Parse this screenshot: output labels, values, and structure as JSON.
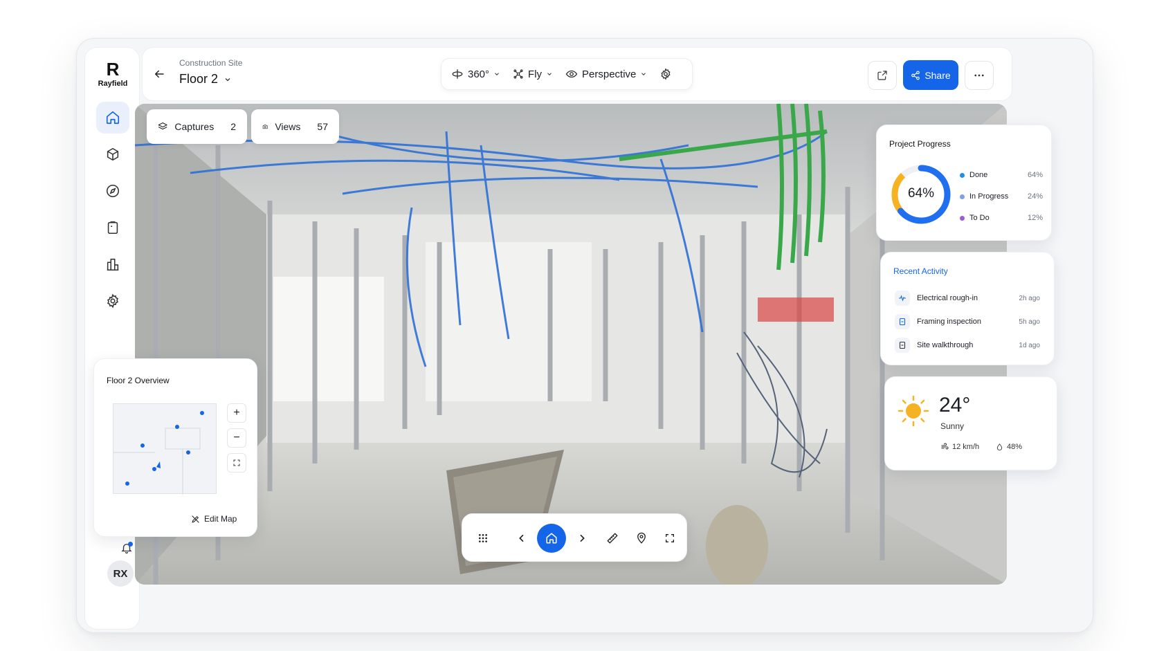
{
  "app": {
    "logo_text": "Rayfield",
    "logo_mark": "R"
  },
  "header": {
    "breadcrumb": "Construction Site",
    "title": "Floor 2",
    "toolbar": {
      "view_mode": "360°",
      "navigation": "Fly",
      "camera": "Perspective"
    },
    "share_label": "Share"
  },
  "sidebar": {
    "items": [
      {
        "icon": "home-icon",
        "active": true
      },
      {
        "icon": "cube-icon"
      },
      {
        "icon": "compass-icon"
      },
      {
        "icon": "clipboard-icon"
      },
      {
        "icon": "bar-chart-icon"
      },
      {
        "icon": "gear-icon"
      }
    ],
    "user_initials": "RX"
  },
  "chips": {
    "captures": {
      "label": "Captures",
      "count": "2"
    },
    "views": {
      "label": "Views",
      "count": "57"
    }
  },
  "progress": {
    "title": "Project Progress",
    "center_label": "64%",
    "items": [
      {
        "label": "Done",
        "value": "64%",
        "color": "#1565e8"
      },
      {
        "label": "In Progress",
        "value": "24%",
        "color": "#6d8fe0"
      },
      {
        "label": "To Do",
        "value": "12%",
        "color": "#9b5cd6"
      }
    ],
    "ring_colors": {
      "done": "#1f6ff0",
      "in_progress": "#f5b324",
      "track": "#eef0f3"
    },
    "ring_values": {
      "done": 0.64,
      "in_progress": 0.24
    }
  },
  "activity": {
    "title": "Recent Activity",
    "items": [
      {
        "label": "Electrical rough-in",
        "time": "2h ago"
      },
      {
        "label": "Framing inspection",
        "time": "5h ago"
      },
      {
        "label": "Site walkthrough",
        "time": "1d ago"
      }
    ]
  },
  "weather": {
    "temperature": "24°",
    "condition": "Sunny",
    "wind": "12 km/h",
    "humidity": "48%"
  },
  "overview": {
    "title": "Floor 2 Overview",
    "edit_label": "Edit Map",
    "zoom_in": "+",
    "zoom_out": "−"
  },
  "colors": {
    "accent": "#1565e8",
    "title_accent": "#1565e8"
  }
}
